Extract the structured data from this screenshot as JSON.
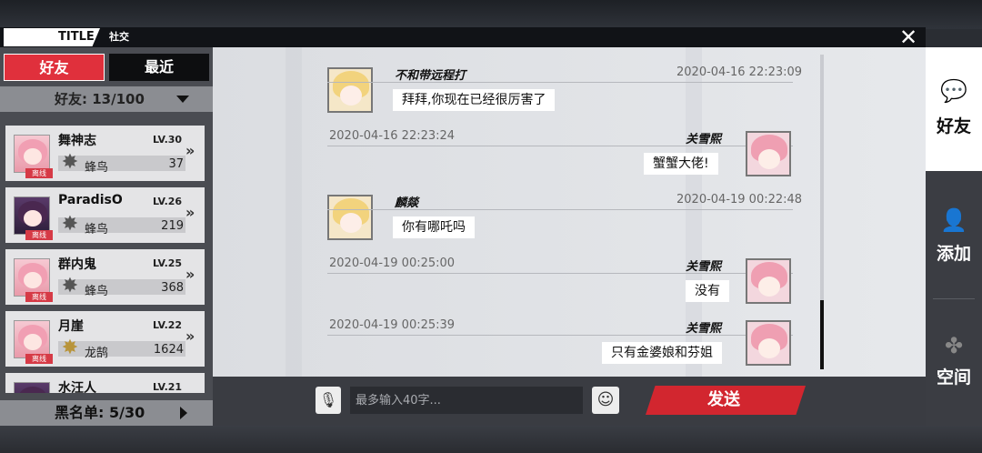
{
  "header": {
    "title_tag": "TITLE",
    "subtitle": "社交"
  },
  "left_panel": {
    "tab_friends": "好友",
    "tab_recent": "最近",
    "friend_count": "好友:  13/100",
    "friends": [
      {
        "name": "舞神志",
        "level": "LV.30",
        "rank": "蜂鸟",
        "score": "37",
        "status": "离线",
        "avatar": "pink"
      },
      {
        "name": "ParadisO",
        "level": "LV.26",
        "rank": "蜂鸟",
        "score": "219",
        "status": "离线",
        "avatar": "dark"
      },
      {
        "name": "群内鬼",
        "level": "LV.25",
        "rank": "蜂鸟",
        "score": "368",
        "status": "离线",
        "avatar": "pink"
      },
      {
        "name": "月崖",
        "level": "LV.22",
        "rank": "龙鹄",
        "score": "1624",
        "status": "离线",
        "avatar": "pink"
      },
      {
        "name": "水汪人",
        "level": "LV.21",
        "rank": "",
        "score": "",
        "status": "",
        "avatar": "dark"
      }
    ],
    "blacklist": "黑名单:  5/30"
  },
  "chat": {
    "messages": [
      {
        "side": "left",
        "sender": "不和带远程打",
        "time": "2020-04-16 22:23:09",
        "text": "拜拜,你现在已经很厉害了",
        "avatar": "blonde"
      },
      {
        "side": "right",
        "sender": "关雪熙",
        "time": "2020-04-16 22:23:24",
        "text": "蟹蟹大佬!",
        "avatar": "pink"
      },
      {
        "side": "left",
        "sender": "麟燚",
        "time": "2020-04-19 00:22:48",
        "text": "你有哪吒吗",
        "avatar": "blonde"
      },
      {
        "side": "right",
        "sender": "关雪熙",
        "time": "2020-04-19 00:25:00",
        "text": "没有",
        "avatar": "pink"
      },
      {
        "side": "right",
        "sender": "关雪熙",
        "time": "2020-04-19 00:25:39",
        "text": "只有金婆娘和芬姐",
        "avatar": "pink"
      }
    ],
    "input_placeholder": "最多输入40字...",
    "send_label": "发送"
  },
  "sidebar": {
    "tabs": [
      {
        "label": "好友",
        "icon": "chat-bubbles-icon",
        "active": true
      },
      {
        "label": "添加",
        "icon": "add-user-icon",
        "active": false
      },
      {
        "label": "空间",
        "icon": "clover-icon",
        "active": false
      }
    ]
  },
  "colors": {
    "accent_red": "#e0303c",
    "send_red": "#d2262f",
    "panel_dark": "#3b3d43"
  }
}
